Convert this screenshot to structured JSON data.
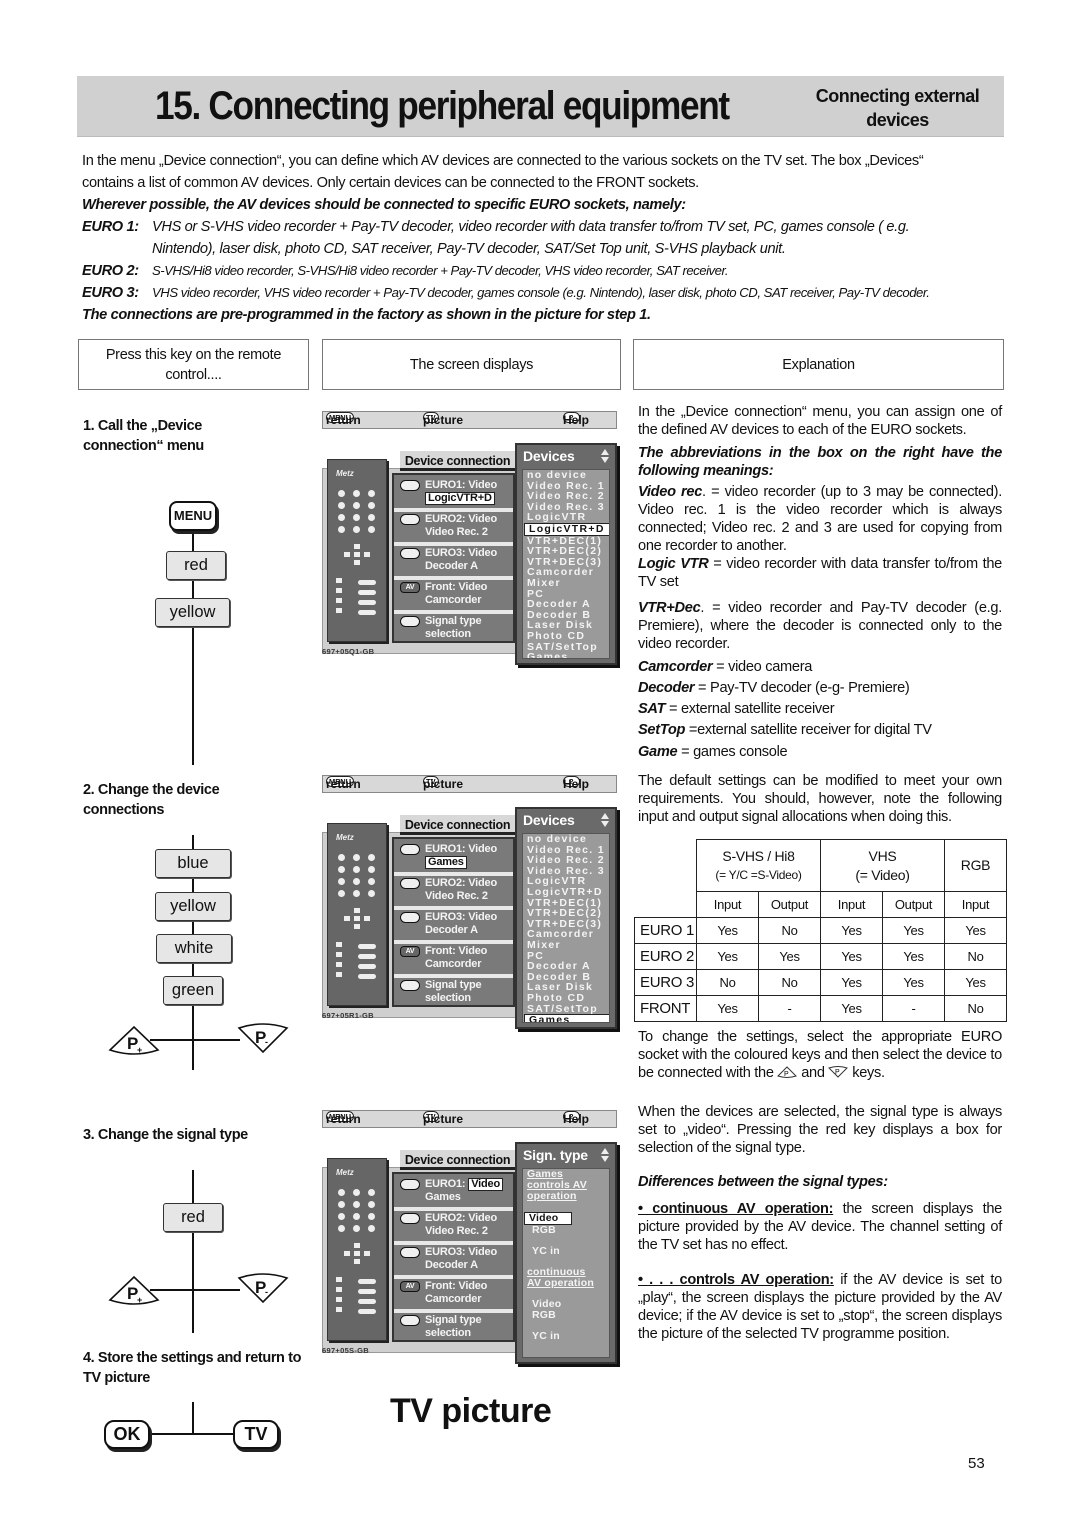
{
  "header": {
    "title": "15. Connecting peripheral equipment",
    "subtitle_line1": "Connecting external",
    "subtitle_line2": "devices"
  },
  "intro": {
    "line1": "In the menu „Device connection“, you can define which AV devices are connected to the various sockets on the TV set. The box „Devices“",
    "line2": "contains a list of common AV devices. Only certain devices can be connected to the FRONT sockets.",
    "bold_line": "Wherever possible, the AV devices should be connected to specific EURO sockets, namely:",
    "euro": [
      {
        "label": "EURO 1:",
        "line1": "VHS or S-VHS video recorder + Pay-TV decoder, video recorder with data transfer to/from TV set, PC, games console ( e.g.",
        "line2": "Nintendo), laser disk, photo CD, SAT receiver, Pay-TV decoder, SAT/Set Top unit, S-VHS playback unit."
      },
      {
        "label": "EURO 2:",
        "line1": "S-VHS/Hi8 video recorder, S-VHS/Hi8 video recorder + Pay-TV decoder, VHS video recorder, SAT receiver."
      },
      {
        "label": "EURO 3:",
        "line1": "VHS video recorder, VHS video recorder + Pay-TV decoder, games console (e.g. Nintendo), laser disk, photo CD, SAT receiver, Pay-TV decoder."
      }
    ],
    "factory_line": "The connections are pre-programmed in the factory as shown in the picture for step 1."
  },
  "columns": {
    "press": "Press this key on the remote control....",
    "screen": "The screen displays",
    "explanation": "Explanation"
  },
  "steps": [
    {
      "title": "1. Call the „Device connection“ menu",
      "keys": [
        "MENU",
        "red",
        "yellow"
      ]
    },
    {
      "title": "2. Change the device connections",
      "keys": [
        "blue",
        "yellow",
        "white",
        "green"
      ],
      "p_plus": "P+",
      "p_minus": "P-"
    },
    {
      "title": "3. Change the signal type",
      "keys": [
        "red"
      ],
      "p_plus": "P+",
      "p_minus": "P-"
    },
    {
      "title": "4. Store the settings and return to TV picture",
      "keys": [
        "OK",
        "TV"
      ]
    }
  ],
  "screen_common": {
    "menu_badge": "MENU",
    "return_label": "return",
    "tv_badge": "TV",
    "picture_label": "picture",
    "help_badge": "?",
    "help_label": "Help",
    "panel_title": "Device connection",
    "remote_brand": "Metz",
    "slots": [
      {
        "label": "EURO1: Video",
        "icon": "euro1-connector-icon"
      },
      {
        "label": "EURO2: Video",
        "value": "Video Rec. 2",
        "icon": "euro2-connector-icon"
      },
      {
        "label": "EURO3: Video",
        "value": "Decoder   A",
        "icon": "euro3-connector-icon"
      },
      {
        "label": "Front: Video",
        "value": "Camcorder",
        "icon": "av-icon",
        "icon_text": "AV"
      },
      {
        "label": "Signal type",
        "value": "selection",
        "icon": "blank-key-icon"
      }
    ],
    "devices_list": [
      "no device",
      "Video Rec. 1",
      "Video Rec. 2",
      "Video Rec. 3",
      "LogicVTR",
      "LogicVTR+D",
      "VTR+DEC(1)",
      "VTR+DEC(2)",
      "VTR+DEC(3)",
      "Camcorder",
      "Mixer",
      "PC",
      "Decoder A",
      "Decoder B",
      "Laser Disk",
      "Photo CD",
      "SAT/SetTop",
      "Games"
    ]
  },
  "screens": [
    {
      "popup_title": "Devices",
      "euro1_value": "LogicVTR+D",
      "euro3_value": "Decoder   A",
      "selected_device": "LogicVTR+D",
      "code": "697+05Q1-GB"
    },
    {
      "popup_title": "Devices",
      "euro1_value": "Games",
      "euro3_value": "Decoder   A",
      "selected_device": "Games",
      "code": "697+05R1-GB"
    },
    {
      "popup_title": "Sign. type",
      "euro1_label": "EURO1:",
      "euro1_type": "Video",
      "euro1_value": "Games",
      "euro3_value": "Decoder A",
      "code": "697+05S-GB",
      "signal_groups": [
        {
          "heading": [
            "Games",
            "controls AV",
            "operation"
          ],
          "options": [
            "Video",
            "RGB",
            "YC in"
          ],
          "selected": "Video"
        },
        {
          "heading": [
            "continuous",
            "AV operation"
          ],
          "options": [
            "Video",
            "RGB",
            "YC in"
          ]
        }
      ]
    }
  ],
  "explanation": {
    "p1": "In the „Device connection“ menu, you can assign one of the defined AV devices to each of the EURO sockets.",
    "abbr_heading": "The abbreviations in the box on the right have the following meanings:",
    "defs": [
      {
        "term": "Video rec",
        "text": ". = video recorder (up to 3 may be connected). Video rec. 1 is the video recorder which is always connected; Video rec. 2 and 3 are used for copying from one recorder to another."
      },
      {
        "term": "Logic VTR",
        "text": " = video recorder with data transfer to/from the TV set"
      },
      {
        "term": "VTR+Dec",
        "text": ". = video recorder and Pay-TV decoder (e.g. Premiere), where the decoder is connected only to the video recorder."
      },
      {
        "term": "Camcorder",
        "text": " = video camera"
      },
      {
        "term": "Decoder",
        "text": " = Pay-TV decoder (e-g- Premiere)"
      },
      {
        "term": "SAT",
        "text": " = external satellite receiver"
      },
      {
        "term": "SetTop",
        "text": " =external satellite receiver for digital TV"
      },
      {
        "term": "Game",
        "text": " = games console"
      }
    ],
    "p_default": "The default settings can be modified to meet your own requirements. You should, however, note the following input and output signal allocations when doing this.",
    "p_change_a": "To change the settings, select the appropriate EURO socket with the coloured keys and then select the device to be connected with the",
    "p_change_and": "and",
    "p_change_b": "keys.",
    "p_selected": "When the devices are selected, the signal type is always set to „video“. Pressing the red key displays a box for selection of the signal type.",
    "diff_heading": "Differences between the signal types:",
    "bullet1_term": "• continuous AV operation:",
    "bullet1_text": " the screen displays the picture provided by the AV device. The channel setting of the TV set has no effect.",
    "bullet2_term": "• . . . controls AV operation:",
    "bullet2_text": " if the AV device is set to „play“, the screen displays the picture provided by the AV device; if the AV device is set to „stop“, the screen displays the picture of the selected TV programme position."
  },
  "signal_table": {
    "groups": [
      {
        "line1": "S-VHS / Hi8",
        "line2": "(= Y/C =S-Video)"
      },
      {
        "line1": "VHS",
        "line2": "(= Video)"
      },
      {
        "line1": "RGB"
      }
    ],
    "subheaders": [
      "Input",
      "Output",
      "Input",
      "Output",
      "Input"
    ],
    "rows": [
      {
        "socket": "EURO 1",
        "values": [
          "Yes",
          "No",
          "Yes",
          "Yes",
          "Yes"
        ]
      },
      {
        "socket": "EURO 2",
        "values": [
          "Yes",
          "Yes",
          "Yes",
          "Yes",
          "No"
        ]
      },
      {
        "socket": "EURO 3",
        "values": [
          "No",
          "No",
          "Yes",
          "Yes",
          "Yes"
        ]
      },
      {
        "socket": "FRONT",
        "values": [
          "Yes",
          "-",
          "Yes",
          "-",
          "No"
        ]
      }
    ]
  },
  "tv_picture_label": "TV picture",
  "page_number": "53"
}
